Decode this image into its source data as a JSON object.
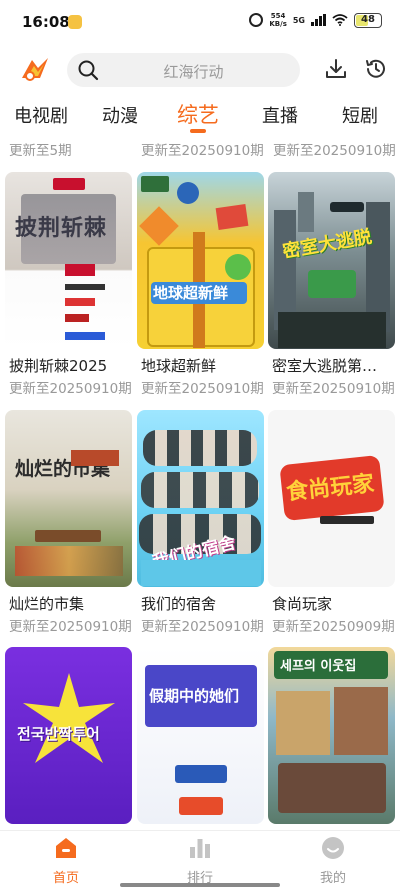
{
  "status_bar": {
    "time": "16:08",
    "speed_value": "554",
    "speed_unit": "KB/s",
    "network": "5G",
    "battery": "48"
  },
  "search": {
    "placeholder": "红海行动"
  },
  "tabs": [
    {
      "label": "电视剧",
      "active": false
    },
    {
      "label": "动漫",
      "active": false
    },
    {
      "label": "综艺",
      "active": true
    },
    {
      "label": "直播",
      "active": false
    },
    {
      "label": "短剧",
      "active": false
    }
  ],
  "previous_row": [
    "更新至5期",
    "更新至20250910期",
    "更新至20250910期"
  ],
  "shows": [
    {
      "title": "披荆斩棘2025",
      "update": "更新至20250910期",
      "poster_text": "披荆斩棘"
    },
    {
      "title": "地球超新鲜",
      "update": "更新至20250910期",
      "poster_text": "地球超新鲜"
    },
    {
      "title": "密室大逃脱第…",
      "update": "更新至20250910期",
      "poster_text": "密室大逃脱"
    },
    {
      "title": "灿烂的市集",
      "update": "更新至20250910期",
      "poster_text": "灿烂的市集"
    },
    {
      "title": "我们的宿舍",
      "update": "更新至20250910期",
      "poster_text": "我们的宿舍"
    },
    {
      "title": "食尚玩家",
      "update": "更新至20250909期",
      "poster_text": "食尚玩家"
    },
    {
      "title": "",
      "update": "",
      "poster_text": "전국반짝투어"
    },
    {
      "title": "",
      "update": "",
      "poster_text": "假期中的她们"
    },
    {
      "title": "",
      "update": "",
      "poster_text": "세프의 이웃집"
    }
  ],
  "bottom_nav": [
    {
      "label": "首页",
      "icon": "home-icon",
      "active": true
    },
    {
      "label": "排行",
      "icon": "ranking-icon",
      "active": false
    },
    {
      "label": "我的",
      "icon": "profile-icon",
      "active": false
    }
  ],
  "colors": {
    "accent": "#f56b1e",
    "muted_text": "#999999"
  }
}
